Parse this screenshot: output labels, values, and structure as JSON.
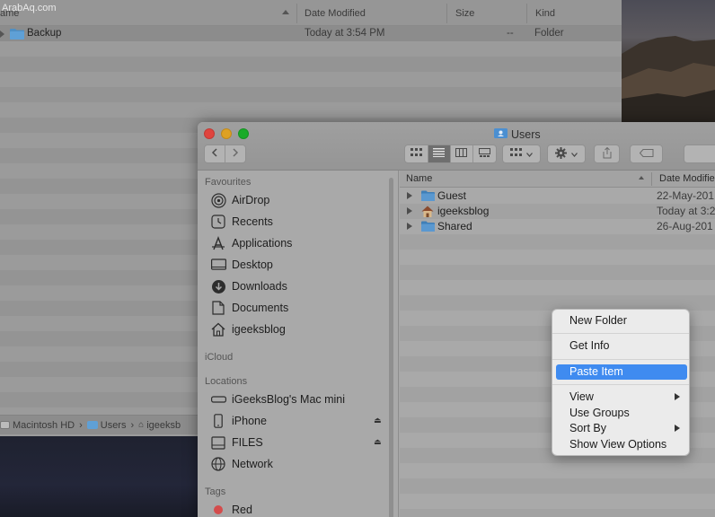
{
  "watermark": "ArabAq.com",
  "background_window": {
    "columns": {
      "name": "ame",
      "date_modified": "Date Modified",
      "size": "Size",
      "kind": "Kind"
    },
    "row": {
      "name": "Backup",
      "date": "Today at 3:54 PM",
      "size": "--",
      "kind": "Folder"
    },
    "path": [
      "Macintosh HD",
      "Users",
      "igeeksb"
    ]
  },
  "window": {
    "title": "Users",
    "colors": {
      "close": "#e0443e",
      "minimize": "#dea123",
      "zoom": "#1aab29"
    }
  },
  "sidebar": {
    "favourites_header": "Favourites",
    "favourites": [
      {
        "label": "AirDrop",
        "icon": "airdrop-icon"
      },
      {
        "label": "Recents",
        "icon": "clock-icon"
      },
      {
        "label": "Applications",
        "icon": "applications-icon"
      },
      {
        "label": "Desktop",
        "icon": "desktop-icon"
      },
      {
        "label": "Downloads",
        "icon": "downloads-icon"
      },
      {
        "label": "Documents",
        "icon": "documents-icon"
      },
      {
        "label": "igeeksblog",
        "icon": "home-icon"
      }
    ],
    "icloud_header": "iCloud",
    "locations_header": "Locations",
    "locations": [
      {
        "label": "iGeeksBlog's Mac mini",
        "icon": "mac-mini-icon"
      },
      {
        "label": "iPhone",
        "icon": "iphone-icon"
      },
      {
        "label": "FILES",
        "icon": "drive-icon"
      },
      {
        "label": "Network",
        "icon": "network-icon"
      }
    ],
    "tags_header": "Tags",
    "tags": [
      {
        "label": "Red",
        "color": "#d44c4c"
      }
    ]
  },
  "list": {
    "headers": {
      "name": "Name",
      "date_modified": "Date Modified"
    },
    "rows": [
      {
        "name": "Guest",
        "date": "22-May-201",
        "icon": "folder-icon"
      },
      {
        "name": "igeeksblog",
        "date": "Today at 3:2",
        "icon": "home-icon"
      },
      {
        "name": "Shared",
        "date": "26-Aug-201",
        "icon": "folder-icon"
      }
    ]
  },
  "context_menu": {
    "items": [
      "New Folder",
      "Get Info",
      "Paste Item",
      "View",
      "Use Groups",
      "Sort By",
      "Show View Options"
    ],
    "highlighted": "Paste Item",
    "accent_color": "#3f8bf0"
  }
}
